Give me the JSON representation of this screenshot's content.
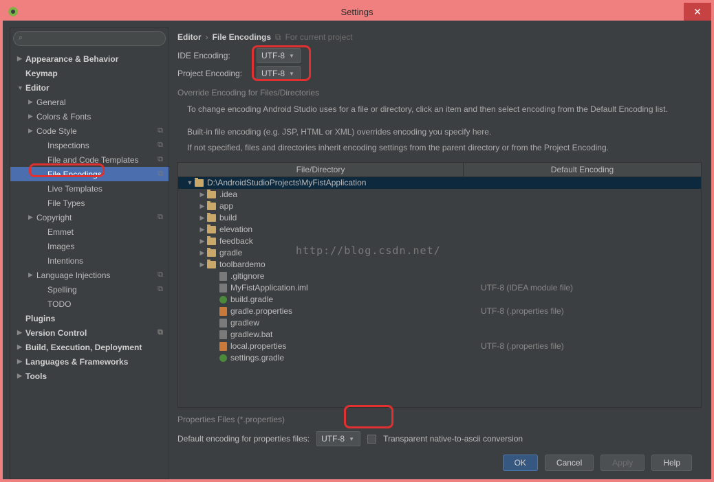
{
  "window": {
    "title": "Settings"
  },
  "search": {
    "placeholder": ""
  },
  "sidebar": {
    "items": [
      {
        "label": "Appearance & Behavior",
        "bold": true,
        "arrow": "▶",
        "indent": 0
      },
      {
        "label": "Keymap",
        "bold": true,
        "arrow": "",
        "indent": 0
      },
      {
        "label": "Editor",
        "bold": true,
        "arrow": "▼",
        "indent": 0
      },
      {
        "label": "General",
        "bold": false,
        "arrow": "▶",
        "indent": 1,
        "copy": false
      },
      {
        "label": "Colors & Fonts",
        "bold": false,
        "arrow": "▶",
        "indent": 1
      },
      {
        "label": "Code Style",
        "bold": false,
        "arrow": "▶",
        "indent": 1,
        "copy": true
      },
      {
        "label": "Inspections",
        "bold": false,
        "arrow": "",
        "indent": 2,
        "copy": true
      },
      {
        "label": "File and Code Templates",
        "bold": false,
        "arrow": "",
        "indent": 2,
        "copy": true
      },
      {
        "label": "File Encodings",
        "bold": false,
        "arrow": "",
        "indent": 2,
        "selected": true,
        "copy": true
      },
      {
        "label": "Live Templates",
        "bold": false,
        "arrow": "",
        "indent": 2
      },
      {
        "label": "File Types",
        "bold": false,
        "arrow": "",
        "indent": 2
      },
      {
        "label": "Copyright",
        "bold": false,
        "arrow": "▶",
        "indent": 1,
        "copy": true
      },
      {
        "label": "Emmet",
        "bold": false,
        "arrow": "",
        "indent": 2
      },
      {
        "label": "Images",
        "bold": false,
        "arrow": "",
        "indent": 2
      },
      {
        "label": "Intentions",
        "bold": false,
        "arrow": "",
        "indent": 2
      },
      {
        "label": "Language Injections",
        "bold": false,
        "arrow": "▶",
        "indent": 1,
        "copy": true
      },
      {
        "label": "Spelling",
        "bold": false,
        "arrow": "",
        "indent": 2,
        "copy": true
      },
      {
        "label": "TODO",
        "bold": false,
        "arrow": "",
        "indent": 2
      },
      {
        "label": "Plugins",
        "bold": true,
        "arrow": "",
        "indent": 0
      },
      {
        "label": "Version Control",
        "bold": true,
        "arrow": "▶",
        "indent": 0,
        "copy": true
      },
      {
        "label": "Build, Execution, Deployment",
        "bold": true,
        "arrow": "▶",
        "indent": 0
      },
      {
        "label": "Languages & Frameworks",
        "bold": true,
        "arrow": "▶",
        "indent": 0
      },
      {
        "label": "Tools",
        "bold": true,
        "arrow": "▶",
        "indent": 0
      }
    ]
  },
  "breadcrumb": {
    "part1": "Editor",
    "sep": "›",
    "part2": "File Encodings",
    "hint": "For current project"
  },
  "form": {
    "ide_label": "IDE Encoding:",
    "ide_value": "UTF-8",
    "proj_label": "Project Encoding:",
    "proj_value": "UTF-8"
  },
  "override": {
    "title": "Override Encoding for Files/Directories",
    "desc1": "To change encoding Android Studio uses for a file or directory, click an item and then select encoding from the Default Encoding list.",
    "desc2": "Built-in file encoding (e.g. JSP, HTML or XML) overrides encoding you specify here.",
    "desc3": "If not specified, files and directories inherit encoding settings from the parent directory or from the Project Encoding."
  },
  "table": {
    "col1": "File/Directory",
    "col2": "Default Encoding",
    "rows": [
      {
        "name": "D:\\AndroidStudioProjects\\MyFistApplication",
        "type": "folder",
        "arrow": "▼",
        "indent": 0,
        "enc": "",
        "sel": true
      },
      {
        "name": ".idea",
        "type": "folder",
        "arrow": "▶",
        "indent": 1,
        "enc": ""
      },
      {
        "name": "app",
        "type": "folder",
        "arrow": "▶",
        "indent": 1,
        "enc": ""
      },
      {
        "name": "build",
        "type": "folder",
        "arrow": "▶",
        "indent": 1,
        "enc": ""
      },
      {
        "name": "elevation",
        "type": "folder",
        "arrow": "▶",
        "indent": 1,
        "enc": ""
      },
      {
        "name": "feedback",
        "type": "folder",
        "arrow": "▶",
        "indent": 1,
        "enc": ""
      },
      {
        "name": "gradle",
        "type": "folder",
        "arrow": "▶",
        "indent": 1,
        "enc": ""
      },
      {
        "name": "toolbardemo",
        "type": "folder",
        "arrow": "▶",
        "indent": 1,
        "enc": ""
      },
      {
        "name": ".gitignore",
        "type": "file",
        "arrow": "",
        "indent": 2,
        "enc": ""
      },
      {
        "name": "MyFistApplication.iml",
        "type": "file",
        "arrow": "",
        "indent": 2,
        "enc": "UTF-8 (IDEA module file)"
      },
      {
        "name": "build.gradle",
        "type": "green",
        "arrow": "",
        "indent": 2,
        "enc": ""
      },
      {
        "name": "gradle.properties",
        "type": "orange",
        "arrow": "",
        "indent": 2,
        "enc": "UTF-8 (.properties file)"
      },
      {
        "name": "gradlew",
        "type": "file",
        "arrow": "",
        "indent": 2,
        "enc": ""
      },
      {
        "name": "gradlew.bat",
        "type": "file",
        "arrow": "",
        "indent": 2,
        "enc": ""
      },
      {
        "name": "local.properties",
        "type": "orange",
        "arrow": "",
        "indent": 2,
        "enc": "UTF-8 (.properties file)"
      },
      {
        "name": "settings.gradle",
        "type": "green",
        "arrow": "",
        "indent": 2,
        "enc": ""
      }
    ]
  },
  "props": {
    "title": "Properties Files (*.properties)",
    "label": "Default encoding for properties files:",
    "value": "UTF-8",
    "checkbox_label": "Transparent native-to-ascii conversion"
  },
  "buttons": {
    "ok": "OK",
    "cancel": "Cancel",
    "apply": "Apply",
    "help": "Help"
  },
  "watermark": "http://blog.csdn.net/"
}
